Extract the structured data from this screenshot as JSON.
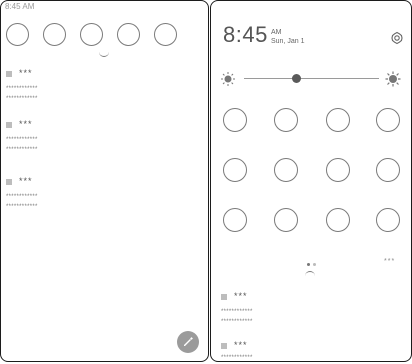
{
  "status_time": "8:45 AM",
  "clock": {
    "time": "8:45",
    "ampm": "AM",
    "date": "Sun, Jan 1"
  },
  "left_quick_settings": [
    "tile",
    "tile",
    "tile",
    "tile",
    "tile"
  ],
  "notifications_left": [
    {
      "title": "***",
      "line1": "************",
      "line2": "************"
    },
    {
      "title": "***",
      "line1": "************",
      "line2": "************"
    },
    {
      "title": "***",
      "line1": "************",
      "line2": "************"
    }
  ],
  "notifications_right": [
    {
      "title": "***",
      "line1": "************",
      "line2": "************"
    },
    {
      "title": "***",
      "line1": "************"
    }
  ],
  "right_more_label": "***",
  "brightness_level": 0.4,
  "page_indicator": {
    "current": 1,
    "total": 2
  },
  "icons": {
    "settings": "gear-icon",
    "brightness_low": "brightness-low-icon",
    "brightness_high": "brightness-high-icon",
    "fab": "edit-icon"
  }
}
